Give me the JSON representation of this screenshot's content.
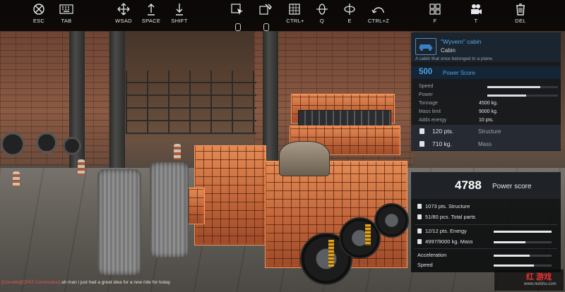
{
  "toolbar": {
    "tools": [
      {
        "key": "ESC",
        "icon": "crossed-circle-icon"
      },
      {
        "key": "TAB",
        "icon": "keyboard-icon"
      },
      {
        "key": "WSAD",
        "icon": "move-arrows-icon"
      },
      {
        "key": "SPACE",
        "icon": "arrow-up-icon"
      },
      {
        "key": "SHIFT",
        "icon": "arrow-down-icon"
      },
      {
        "key": "",
        "icon": "select-part-icon"
      },
      {
        "key": "",
        "icon": "hammer-icon"
      },
      {
        "key": "CTRL+",
        "icon": "grid-box-icon"
      },
      {
        "key": "Q",
        "icon": "rotate-vertical-icon"
      },
      {
        "key": "E",
        "icon": "rotate-horizontal-icon"
      },
      {
        "key": "CTRL+Z",
        "icon": "undo-icon"
      },
      {
        "key": "F",
        "icon": "four-squares-icon"
      },
      {
        "key": "T",
        "icon": "camera-icon"
      },
      {
        "key": "DEL",
        "icon": "trash-icon"
      }
    ]
  },
  "part": {
    "name": "\"Wyvern\" cabin",
    "category": "Cabin",
    "description": "A cabin that once belonged to a plane.",
    "power": "500",
    "power_label": "Power Score",
    "stats": [
      {
        "label": "Speed",
        "value": "",
        "level": 0.75
      },
      {
        "label": "Power",
        "value": "",
        "level": 0.55
      },
      {
        "label": "Tonnage",
        "value": "4500 kg."
      },
      {
        "label": "Mass limit",
        "value": "9000 kg."
      },
      {
        "label": "Adds energy",
        "value": "10 pts."
      }
    ],
    "structure_value": "120 pts.",
    "structure_label": "Structure",
    "mass_value": "710 kg.",
    "mass_label": "Mass"
  },
  "vehicle": {
    "power_score": "4788",
    "power_label": "Power score",
    "structure": "1073 pts. Structure",
    "parts": "51/80 pcs. Total parts",
    "energy": "12/12 pts. Energy",
    "energy_level": 1.0,
    "mass": "4997/9000 kg. Mass",
    "mass_level": 0.55,
    "acceleration_label": "Acceleration",
    "acceleration_level": 0.62,
    "speed_label": "Speed",
    "speed_level": 0.7
  },
  "chat": {
    "name": "[Corvette][CPAT-Commodus]",
    "message": "ah man i just had a great idea for a new ride for today"
  },
  "watermark": {
    "logo": "红 游戏",
    "site": "www.redshu.com"
  },
  "colors": {
    "accent": "#4aa3e8",
    "parts_highlight": "#e38b55",
    "chat_name": "#e25757"
  }
}
